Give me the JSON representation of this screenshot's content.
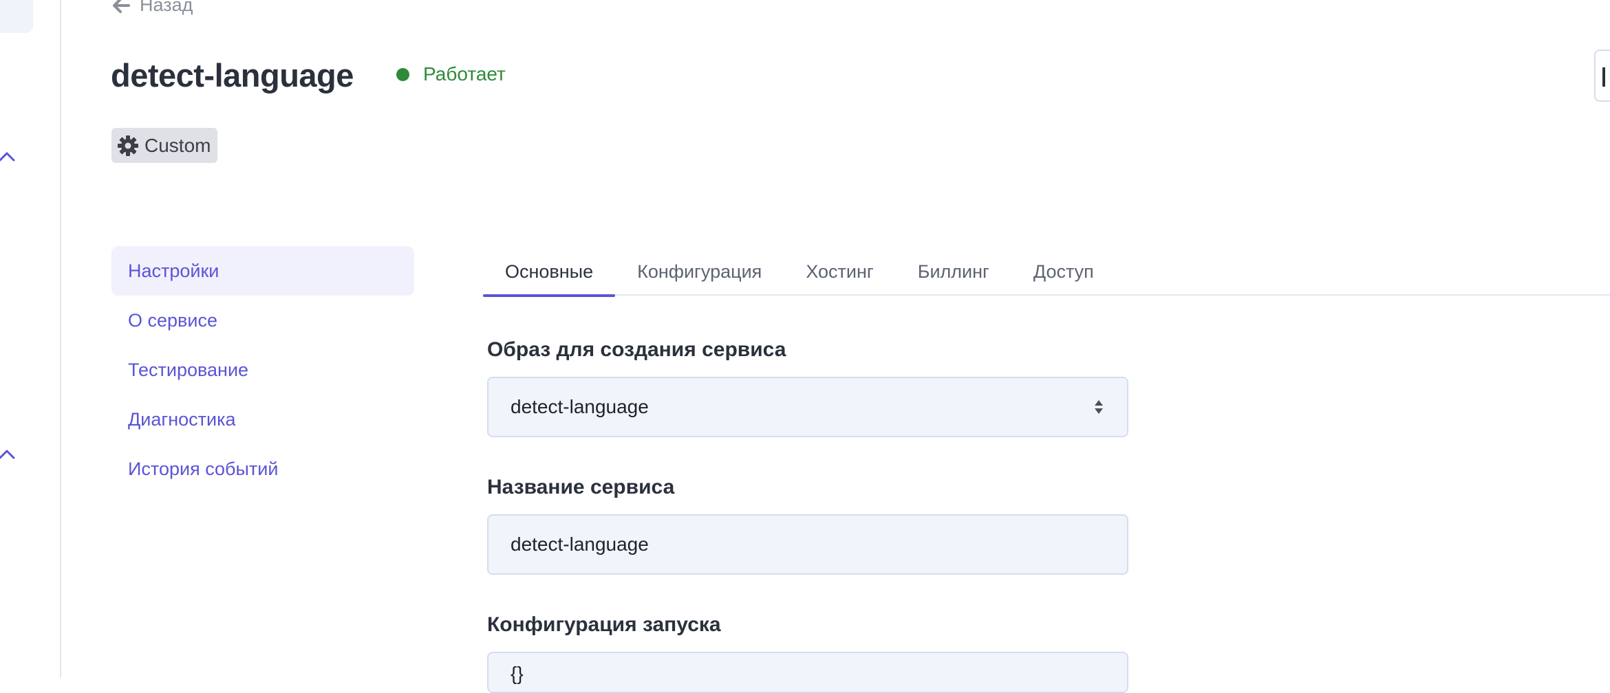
{
  "back": {
    "label": "Назад"
  },
  "header": {
    "title": "detect-language",
    "status": "Работает",
    "badge": "Custom"
  },
  "side_menu": {
    "items": [
      {
        "label": "Настройки",
        "active": true
      },
      {
        "label": "О сервисе",
        "active": false
      },
      {
        "label": "Тестирование",
        "active": false
      },
      {
        "label": "Диагностика",
        "active": false
      },
      {
        "label": "История событий",
        "active": false
      }
    ]
  },
  "tabs": [
    {
      "label": "Основные",
      "active": true
    },
    {
      "label": "Конфигурация",
      "active": false
    },
    {
      "label": "Хостинг",
      "active": false
    },
    {
      "label": "Биллинг",
      "active": false
    },
    {
      "label": "Доступ",
      "active": false
    }
  ],
  "form": {
    "image": {
      "label": "Образ для создания сервиса",
      "value": "detect-language"
    },
    "name": {
      "label": "Название сервиса",
      "value": "detect-language"
    },
    "config": {
      "label": "Конфигурация запуска",
      "value": "{}"
    }
  },
  "colors": {
    "accent": "#5b54d6",
    "status_ok": "#2f8a3a",
    "field_bg": "#f1f4fb"
  }
}
